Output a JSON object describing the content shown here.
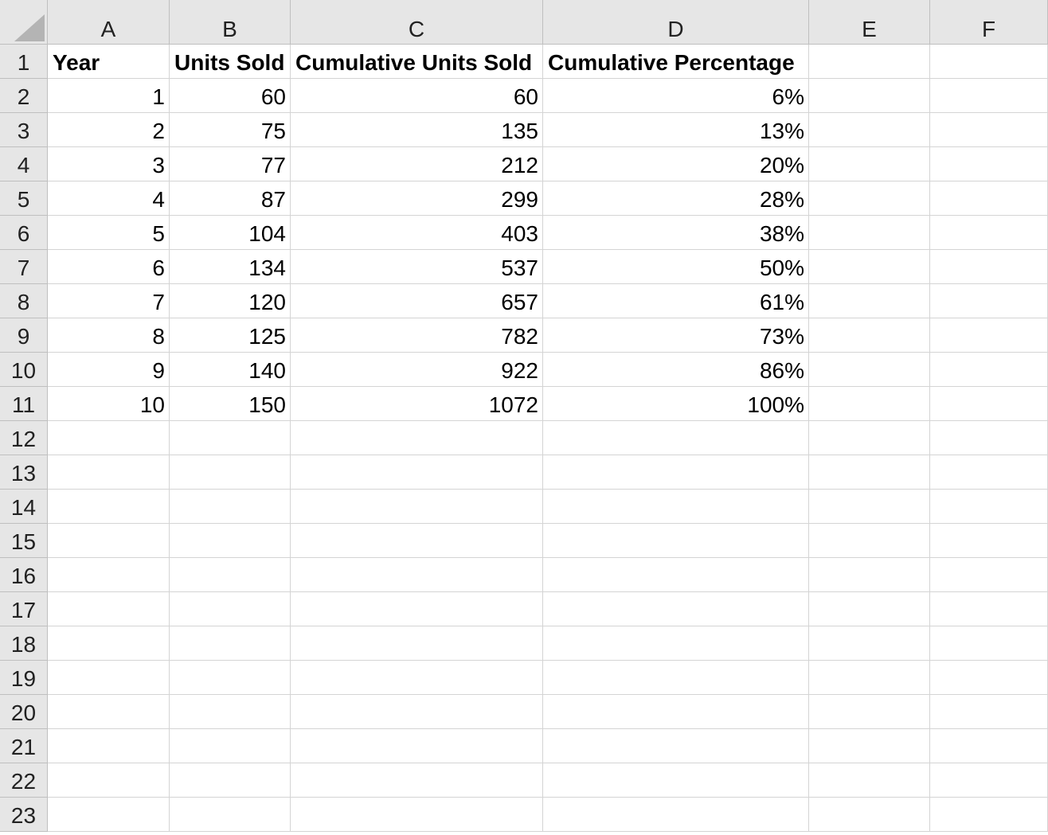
{
  "spreadsheet": {
    "columns": [
      "A",
      "B",
      "C",
      "D",
      "E",
      "F"
    ],
    "row_numbers": [
      "1",
      "2",
      "3",
      "4",
      "5",
      "6",
      "7",
      "8",
      "9",
      "10",
      "11",
      "12",
      "13",
      "14",
      "15",
      "16",
      "17",
      "18",
      "19",
      "20",
      "21",
      "22",
      "23"
    ],
    "header_row": [
      "Year",
      "Units Sold",
      "Cumulative Units Sold",
      "Cumulative Percentage",
      "",
      ""
    ],
    "rows": [
      [
        "1",
        "60",
        "60",
        "6%",
        "",
        ""
      ],
      [
        "2",
        "75",
        "135",
        "13%",
        "",
        ""
      ],
      [
        "3",
        "77",
        "212",
        "20%",
        "",
        ""
      ],
      [
        "4",
        "87",
        "299",
        "28%",
        "",
        ""
      ],
      [
        "5",
        "104",
        "403",
        "38%",
        "",
        ""
      ],
      [
        "6",
        "134",
        "537",
        "50%",
        "",
        ""
      ],
      [
        "7",
        "120",
        "657",
        "61%",
        "",
        ""
      ],
      [
        "8",
        "125",
        "782",
        "73%",
        "",
        ""
      ],
      [
        "9",
        "140",
        "922",
        "86%",
        "",
        ""
      ],
      [
        "10",
        "150",
        "1072",
        "100%",
        "",
        ""
      ]
    ],
    "empty_row_count": 12,
    "colors": {
      "header_background": "#e6e6e6",
      "gridline": "#d4d4d4",
      "header_border": "#bfbfbf"
    },
    "select_all_icon": "select-all-triangle-icon"
  }
}
